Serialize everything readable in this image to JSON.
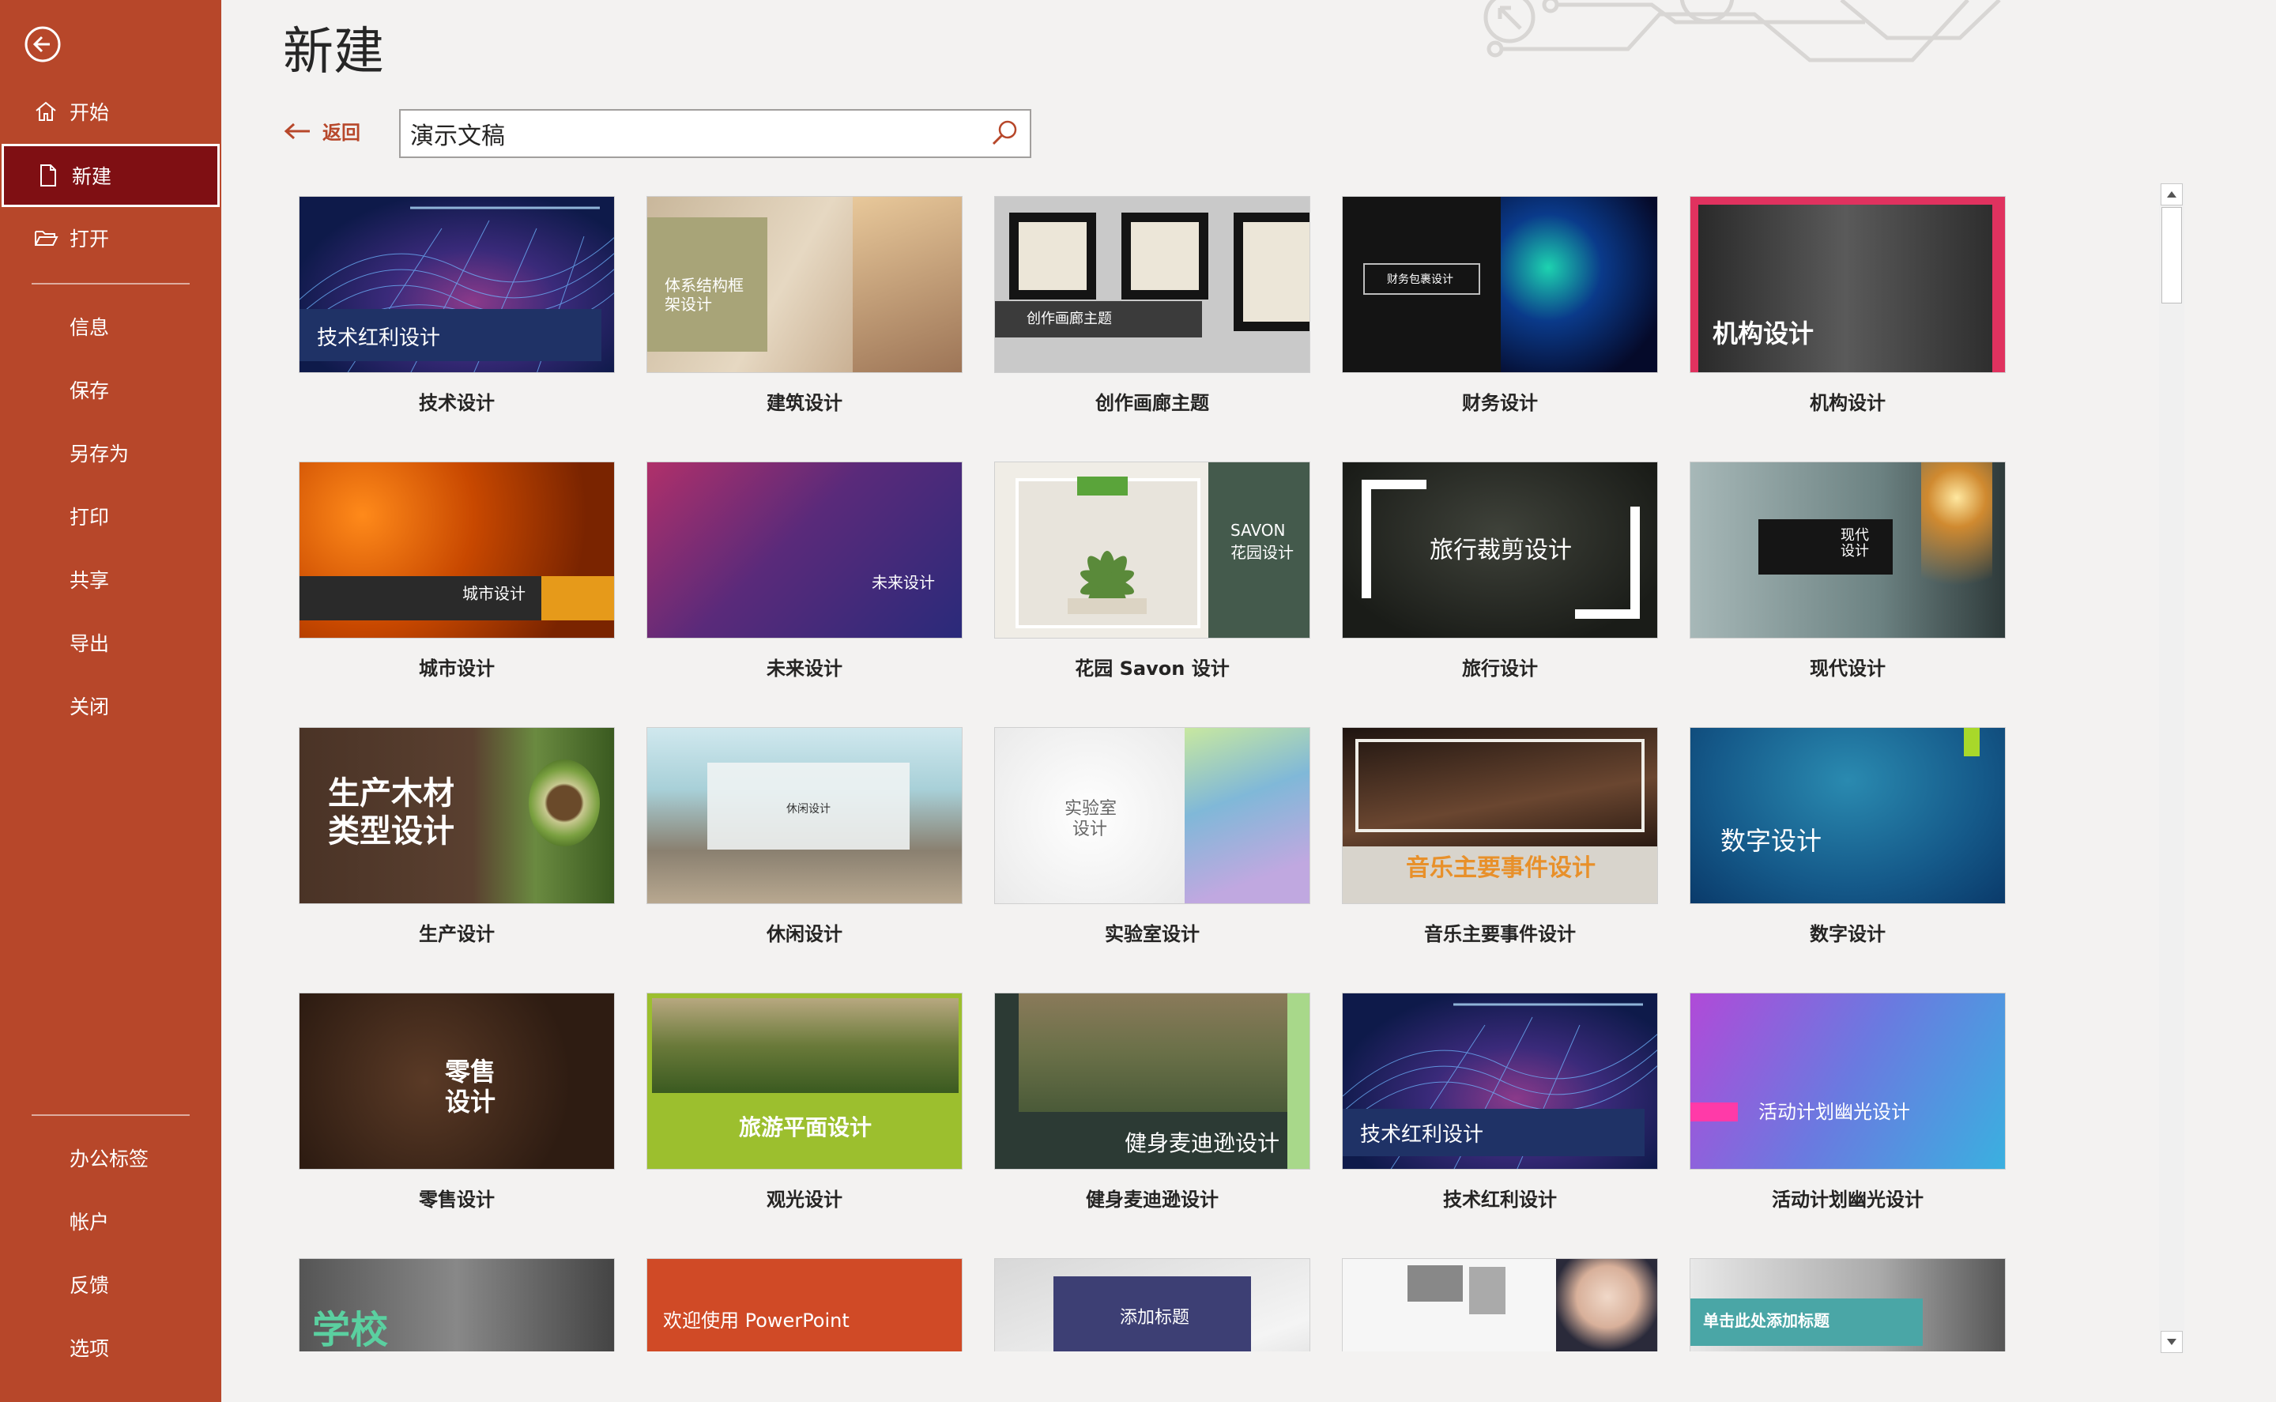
{
  "sidebar": {
    "items": [
      {
        "label": "开始",
        "icon": "home-icon"
      },
      {
        "label": "新建",
        "icon": "new-document-icon",
        "active": true
      },
      {
        "label": "打开",
        "icon": "folder-open-icon"
      },
      {
        "label": "信息"
      },
      {
        "label": "保存"
      },
      {
        "label": "另存为"
      },
      {
        "label": "打印"
      },
      {
        "label": "共享"
      },
      {
        "label": "导出"
      },
      {
        "label": "关闭"
      }
    ],
    "bottom_items": [
      {
        "label": "办公标签"
      },
      {
        "label": "帐户"
      },
      {
        "label": "反馈"
      },
      {
        "label": "选项"
      }
    ]
  },
  "main": {
    "title": "新建",
    "back_label": "返回",
    "search_value": "演示文稿"
  },
  "thumbs": {
    "t1": "技术红利设计",
    "t2": "体系结构框架设计",
    "t3": "创作画廊主题",
    "t4": "财务包裹设计",
    "t5": "机构设计",
    "t6": "城市设计",
    "t7": "未来设计",
    "t8a": "SAVON",
    "t8b": "花园设计",
    "t9": "旅行裁剪设计",
    "t10a": "现代",
    "t10b": "设计",
    "t11a": "生产木材",
    "t11b": "类型设计",
    "t12": "休闲设计",
    "t13a": "实验室",
    "t13b": "设计",
    "t14": "音乐主要事件设计",
    "t15": "数字设计",
    "t16a": "零售",
    "t16b": "设计",
    "t17": "旅游平面设计",
    "t18": "健身麦迪逊设计",
    "t19": "技术红利设计",
    "t20": "活动计划幽光设计",
    "t21": "学校",
    "t22": "欢迎使用 PowerPoint",
    "t23": "添加标题",
    "t25": "单击此处添加标题"
  },
  "templates": [
    {
      "name": "技术设计"
    },
    {
      "name": "建筑设计"
    },
    {
      "name": "创作画廊主题"
    },
    {
      "name": "财务设计"
    },
    {
      "name": "机构设计"
    },
    {
      "name": "城市设计"
    },
    {
      "name": "未来设计"
    },
    {
      "name": "花园 Savon 设计"
    },
    {
      "name": "旅行设计"
    },
    {
      "name": "现代设计"
    },
    {
      "name": "生产设计"
    },
    {
      "name": "休闲设计"
    },
    {
      "name": "实验室设计"
    },
    {
      "name": "音乐主要事件设计"
    },
    {
      "name": "数字设计"
    },
    {
      "name": "零售设计"
    },
    {
      "name": "观光设计"
    },
    {
      "name": "健身麦迪逊设计"
    },
    {
      "name": "技术红利设计"
    },
    {
      "name": "活动计划幽光设计"
    }
  ],
  "colors": {
    "sidebar_bg": "#b7472a",
    "sidebar_active": "#7f0f13",
    "accent": "#b7472a",
    "page_bg": "#f3f2f1"
  }
}
